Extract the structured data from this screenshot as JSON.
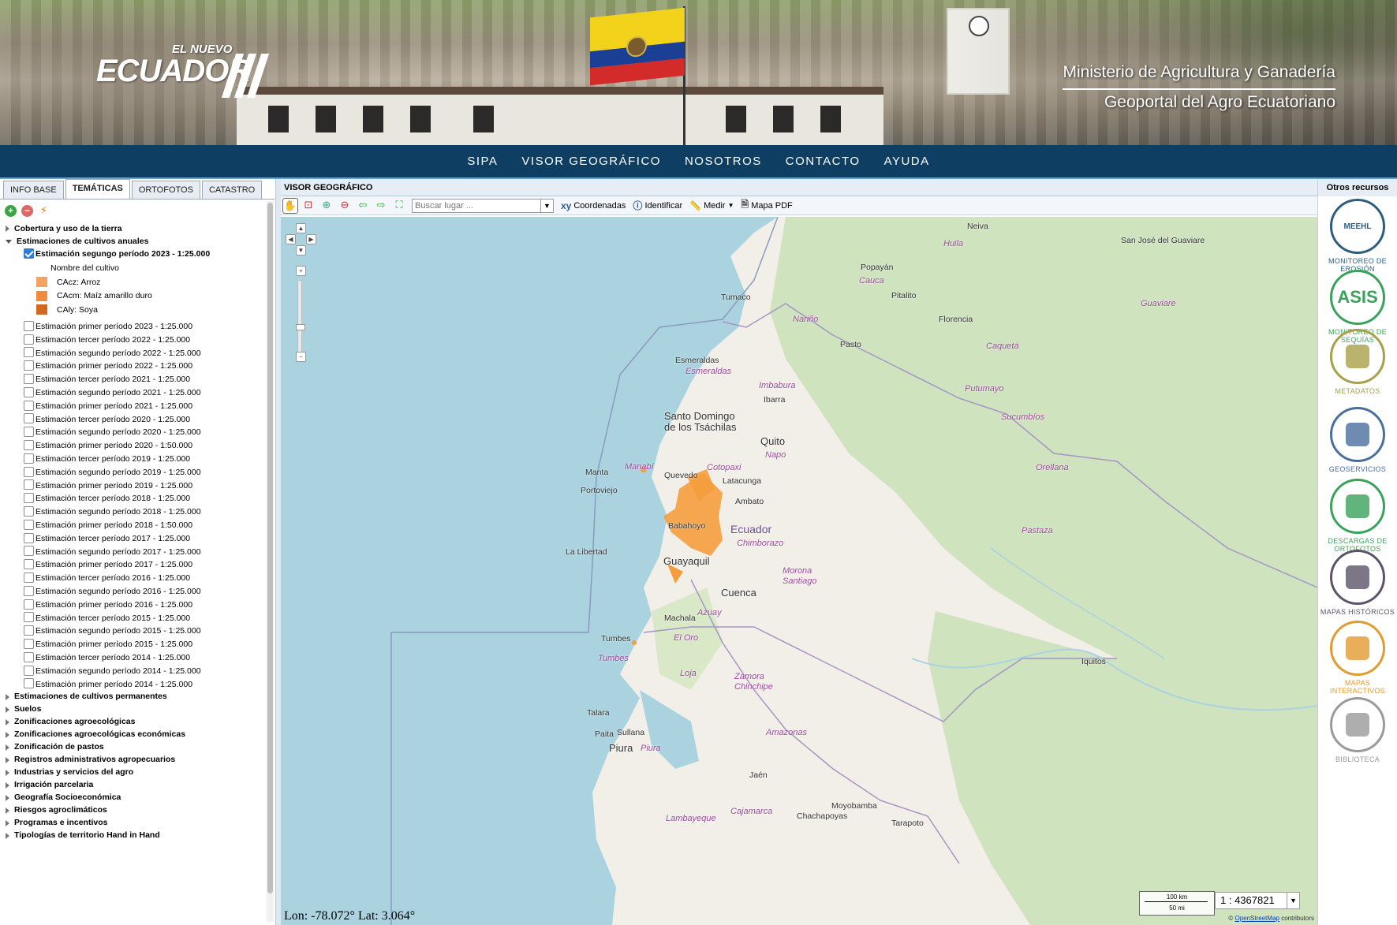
{
  "header": {
    "logo_small": "EL NUEVO",
    "logo_big": "ECUADOR",
    "ministry": "Ministerio de Agricultura y Ganadería",
    "geoportal": "Geoportal del Agro Ecuatoriano"
  },
  "nav": [
    "SIPA",
    "VISOR GEOGRÁFICO",
    "NOSOTROS",
    "CONTACTO",
    "AYUDA"
  ],
  "left": {
    "tabs": [
      {
        "label": "INFO BASE",
        "active": false
      },
      {
        "label": "TEMÁTICAS",
        "active": true
      },
      {
        "label": "ORTOFOTOS",
        "active": false
      },
      {
        "label": "CATASTRO",
        "active": false
      }
    ],
    "top_categories": [
      "Cobertura y uso de la tierra",
      "Estimaciones de cultivos anuales"
    ],
    "selected_layer": "Estimación segungo período 2023 - 1:25.000",
    "legend_title": "Nombre del cultivo",
    "legend": [
      {
        "label": "CAcz: Arroz",
        "color": "#f4a460"
      },
      {
        "label": "CAcm: Maíz amarillo duro",
        "color": "#f08a3c"
      },
      {
        "label": "CAly: Soya",
        "color": "#d2691e"
      }
    ],
    "layers": [
      "Estimación primer período 2023 - 1:25.000",
      "Estimación tercer período 2022 - 1:25.000",
      "Estimación segundo período 2022 - 1:25.000",
      "Estimación primer período 2022 - 1:25.000",
      "Estimación tercer período 2021 - 1:25.000",
      "Estimación segundo período 2021 - 1:25.000",
      "Estimación primer período 2021 - 1:25.000",
      "Estimación tercer período 2020 - 1:25.000",
      "Estimación segundo período 2020 - 1:25.000",
      "Estimación primer período 2020 - 1:50.000",
      "Estimación tercer período 2019 - 1:25.000",
      "Estimación segundo período 2019 - 1:25.000",
      "Estimación primer período 2019 - 1:25.000",
      "Estimación tercer período 2018 - 1:25.000",
      "Estimación segundo período 2018 - 1:25.000",
      "Estimación primer período 2018 - 1:50.000",
      "Estimación tercer período 2017 - 1:25.000",
      "Estimación segundo período 2017 - 1:25.000",
      "Estimación primer período 2017 - 1:25.000",
      "Estimación tercer período 2016 - 1:25.000",
      "Estimación segundo período 2016 - 1:25.000",
      "Estimación primer período 2016 - 1:25.000",
      "Estimación tercer período 2015 - 1:25.000",
      "Estimación segundo período 2015 - 1:25.000",
      "Estimación primer período 2015 - 1:25.000",
      "Estimación tercer período 2014 - 1:25.000",
      "Estimación segundo período 2014 - 1:25.000",
      "Estimación primer período 2014 - 1:25.000"
    ],
    "bottom_categories": [
      "Estimaciones de cultivos permanentes",
      "Suelos",
      "Zonificaciones agroecológicas",
      "Zonificaciones agroecológicas económicas",
      "Zonificación de pastos",
      "Registros administrativos agropecuarios",
      "Industrias y servicios del agro",
      "Irrigación parcelaria",
      "Geografía Socioeconómica",
      "Riesgos agroclimáticos",
      "Programas e incentivos",
      "Tipologías de territorio Hand in Hand"
    ]
  },
  "viewer": {
    "title": "VISOR GEOGRÁFICO",
    "search_placeholder": "Buscar lugar ...",
    "btn_coords": "Coordenadas",
    "btn_identify": "Identificar",
    "btn_measure": "Medir",
    "btn_pdf": "Mapa PDF",
    "coords": "Lon: -78.072°  Lat: 3.064°",
    "scale_km": "100 km",
    "scale_mi": "50 mi",
    "scale_value": "1 : 4367821",
    "attribution_prefix": "©",
    "attribution_link": "OpenStreetMap",
    "attribution_suffix": "contributors",
    "places": [
      {
        "t": "Neiva",
        "c": "place"
      },
      {
        "t": "Huila",
        "c": "place region"
      },
      {
        "t": "San José del Guaviare",
        "c": "place"
      },
      {
        "t": "Popayán",
        "c": "place"
      },
      {
        "t": "Cauca",
        "c": "place region"
      },
      {
        "t": "Pitalito",
        "c": "place"
      },
      {
        "t": "Guaviare",
        "c": "place region"
      },
      {
        "t": "Tumaco",
        "c": "place"
      },
      {
        "t": "Florencia",
        "c": "place"
      },
      {
        "t": "Nariño",
        "c": "place region"
      },
      {
        "t": "Pasto",
        "c": "place"
      },
      {
        "t": "Caquetá",
        "c": "place region"
      },
      {
        "t": "Esmeraldas",
        "c": "place"
      },
      {
        "t": "Esmeraldas",
        "c": "place region"
      },
      {
        "t": "Imbabura",
        "c": "place region"
      },
      {
        "t": "Putumayo",
        "c": "place region"
      },
      {
        "t": "Ibarra",
        "c": "place"
      },
      {
        "t": "Sucumbíos",
        "c": "place region"
      },
      {
        "t": "Santo Domingo",
        "c": "place big"
      },
      {
        "t": "de los Tsáchilas",
        "c": "place big"
      },
      {
        "t": "Quito",
        "c": "place big"
      },
      {
        "t": "Napo",
        "c": "place region"
      },
      {
        "t": "Orellana",
        "c": "place region"
      },
      {
        "t": "Cotopaxi",
        "c": "place region"
      },
      {
        "t": "Manta",
        "c": "place"
      },
      {
        "t": "Manabí",
        "c": "place region"
      },
      {
        "t": "Quevedo",
        "c": "place"
      },
      {
        "t": "Latacunga",
        "c": "place"
      },
      {
        "t": "Portoviejo",
        "c": "place"
      },
      {
        "t": "Ambato",
        "c": "place"
      },
      {
        "t": "Babahoyo",
        "c": "place"
      },
      {
        "t": "Ecuador",
        "c": "place country"
      },
      {
        "t": "Pastaza",
        "c": "place region"
      },
      {
        "t": "La Libertad",
        "c": "place"
      },
      {
        "t": "Chimborazo",
        "c": "place region"
      },
      {
        "t": "Guayaquil",
        "c": "place big"
      },
      {
        "t": "Morona",
        "c": "place region"
      },
      {
        "t": "Santiago",
        "c": "place region"
      },
      {
        "t": "Cuenca",
        "c": "place big"
      },
      {
        "t": "Azuay",
        "c": "place region"
      },
      {
        "t": "Machala",
        "c": "place"
      },
      {
        "t": "Tumbes",
        "c": "place"
      },
      {
        "t": "El Oro",
        "c": "place region"
      },
      {
        "t": "Iquitos",
        "c": "place"
      },
      {
        "t": "Tumbes",
        "c": "place region"
      },
      {
        "t": "Loja",
        "c": "place region"
      },
      {
        "t": "Zamora",
        "c": "place region"
      },
      {
        "t": "Chinchipe",
        "c": "place region"
      },
      {
        "t": "Talara",
        "c": "place"
      },
      {
        "t": "Paita",
        "c": "place"
      },
      {
        "t": "Sullana",
        "c": "place"
      },
      {
        "t": "Amazonas",
        "c": "place region"
      },
      {
        "t": "Piura",
        "c": "place big"
      },
      {
        "t": "Piura",
        "c": "place region"
      },
      {
        "t": "Jaén",
        "c": "place"
      },
      {
        "t": "Cajamarca",
        "c": "place region"
      },
      {
        "t": "Moyobamba",
        "c": "place"
      },
      {
        "t": "Lambayeque",
        "c": "place region"
      },
      {
        "t": "Chachapoyas",
        "c": "place"
      },
      {
        "t": "Tarapoto",
        "c": "place"
      }
    ]
  },
  "right": {
    "title": "Otros recursos",
    "resources": [
      {
        "label": "MONITOREO DE EROSIÓN",
        "badge": "MEEHL",
        "color": "#2e5e7e",
        "icon": "erosion-icon"
      },
      {
        "label": "MONITOREO DE SEQUÍAS",
        "badge": "ASIS",
        "color": "#3aa35b",
        "icon": "drought-icon"
      },
      {
        "label": "METADATOS",
        "badge": "",
        "color": "#a8a04a",
        "icon": "metadata-icon"
      },
      {
        "label": "GEOSERVICIOS",
        "badge": "",
        "color": "#4a6f9e",
        "icon": "geoservices-icon"
      },
      {
        "label": "DESCARGAS DE ORTOFOTOS",
        "badge": "",
        "color": "#3aa35b",
        "icon": "download-icon"
      },
      {
        "label": "MAPAS HISTÓRICOS",
        "badge": "",
        "color": "#5d5468",
        "icon": "historic-map-icon"
      },
      {
        "label": "MAPAS INTERACTIVOS",
        "badge": "",
        "color": "#e39a2f",
        "icon": "interactive-map-icon"
      },
      {
        "label": "BIBLIOTECA",
        "badge": "",
        "color": "#9a9a9a",
        "icon": "library-icon"
      }
    ]
  }
}
